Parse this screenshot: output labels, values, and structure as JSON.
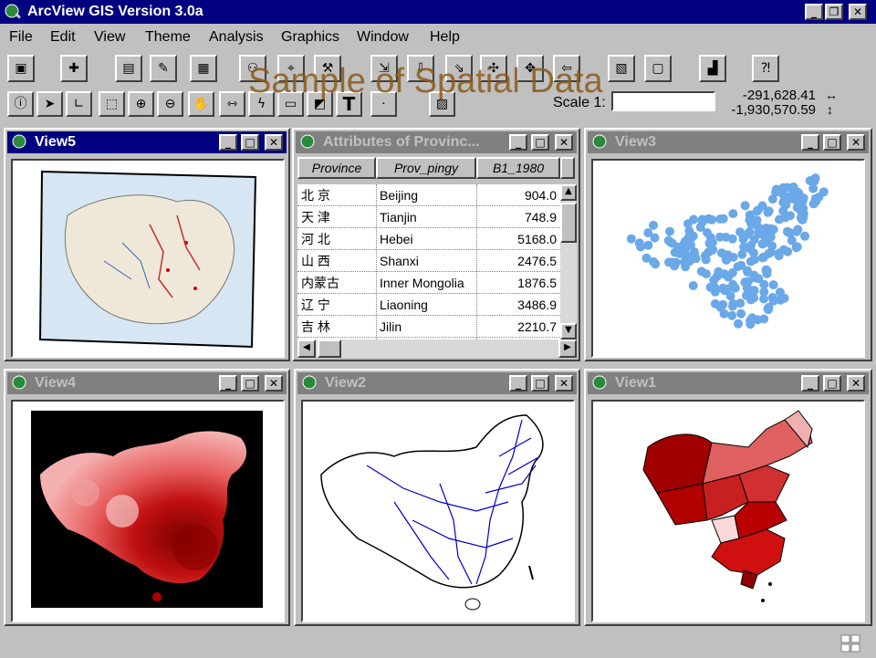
{
  "app": {
    "title": "ArcView GIS Version 3.0a"
  },
  "menu": [
    "File",
    "Edit",
    "View",
    "Theme",
    "Analysis",
    "Graphics",
    "Window",
    "Help"
  ],
  "overlay_title": "Sample of Spatial Data",
  "scale": {
    "label": "Scale 1:",
    "value": ""
  },
  "coords": {
    "x": "-291,628.41",
    "y": "-1,930,570.59"
  },
  "windows": {
    "view5": {
      "title": "View5"
    },
    "attributes": {
      "title": "Attributes of Provinc..."
    },
    "view3": {
      "title": "View3"
    },
    "view4": {
      "title": "View4"
    },
    "view2": {
      "title": "View2"
    },
    "view1": {
      "title": "View1"
    }
  },
  "table": {
    "columns": [
      "Province",
      "Prov_pingy",
      "B1_1980"
    ],
    "rows": [
      {
        "province": "北 京",
        "pinyin": "Beijing",
        "value": "904.0"
      },
      {
        "province": "天 津",
        "pinyin": "Tianjin",
        "value": "748.9"
      },
      {
        "province": "河 北",
        "pinyin": "Hebei",
        "value": "5168.0"
      },
      {
        "province": "山 西",
        "pinyin": "Shanxi",
        "value": "2476.5"
      },
      {
        "province": "内蒙古",
        "pinyin": "Inner Mongolia",
        "value": "1876.5"
      },
      {
        "province": "辽 宁",
        "pinyin": "Liaoning",
        "value": "3486.9"
      },
      {
        "province": "吉 林",
        "pinyin": "Jilin",
        "value": "2210.7"
      }
    ]
  },
  "colors": {
    "title_active": "#000080",
    "title_inactive": "#808080",
    "points": "#6aa8e8",
    "rail": "#0000cc",
    "dark_red": "#9a0000"
  }
}
